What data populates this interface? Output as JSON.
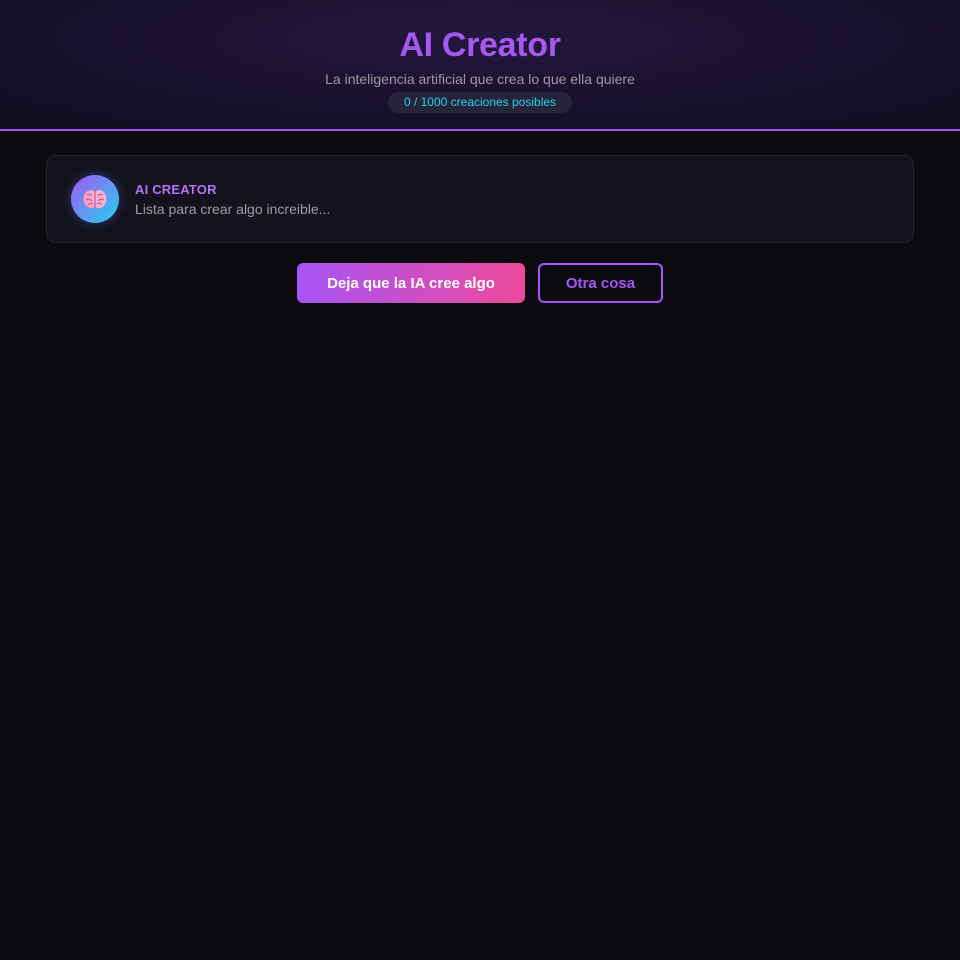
{
  "header": {
    "title": "AI Creator",
    "subtitle": "La inteligencia artificial que crea lo que ella quiere",
    "counter": "0 / 1000 creaciones posibles"
  },
  "card": {
    "avatar_icon": "brain-icon",
    "name": "AI CREATOR",
    "message": "Lista para crear algo increible..."
  },
  "actions": {
    "primary_label": "Deja que la IA cree algo",
    "secondary_label": "Otra cosa"
  },
  "colors": {
    "accent": "#a855f7",
    "accent_pink": "#ec4899",
    "cyan": "#22d3ee",
    "background": "#0b0a0f"
  }
}
